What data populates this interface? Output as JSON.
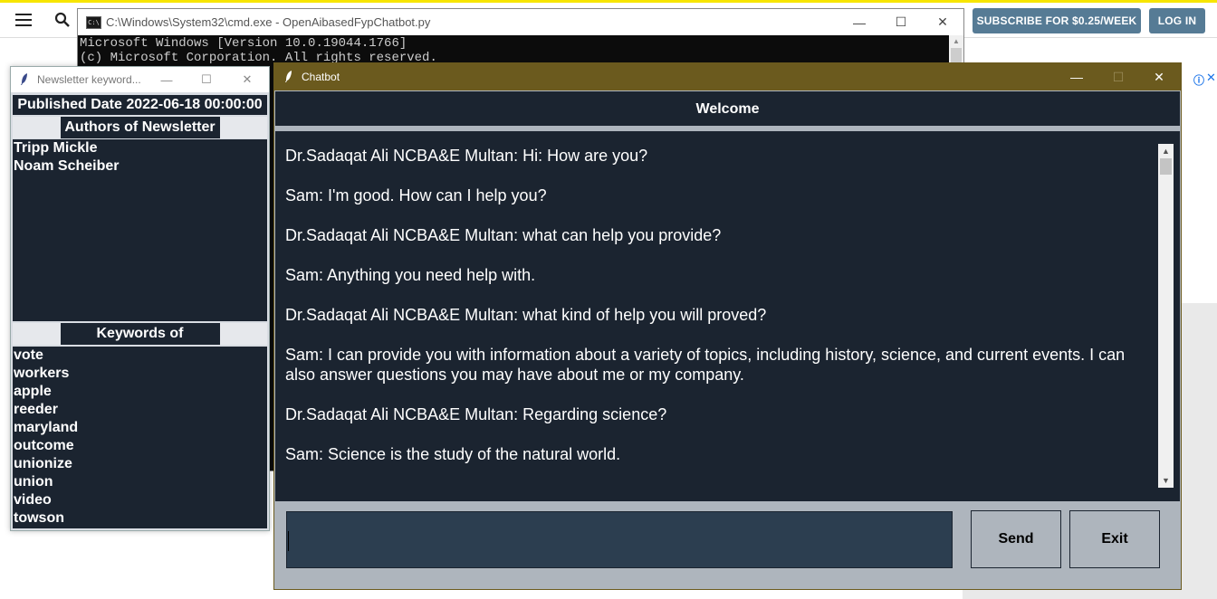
{
  "browser": {
    "subscribe_label": "SUBSCRIBE FOR $0.25/WEEK",
    "login_label": "LOG IN",
    "ad_info": "ⓘ",
    "ad_close": "✕"
  },
  "cmd": {
    "title": "C:\\Windows\\System32\\cmd.exe - OpenAibasedFypChatbot.py",
    "lines": [
      "Microsoft Windows [Version 10.0.19044.1766]",
      "(c) Microsoft Corporation. All rights reserved."
    ]
  },
  "newsletter": {
    "title": "Newsletter keyword...",
    "published": "Published Date 2022-06-18 00:00:00",
    "authors_heading": "Authors of Newsletter",
    "authors": [
      "Tripp Mickle",
      "Noam Scheiber"
    ],
    "keywords_heading": "Keywords of Newsletter",
    "keywords": [
      "vote",
      "workers",
      "apple",
      "reeder",
      "maryland",
      "outcome",
      "unionize",
      "union",
      "video",
      "towson"
    ]
  },
  "chatbot": {
    "title": "Chatbot",
    "header": "Welcome",
    "messages": [
      "Dr.Sadaqat Ali NCBA&E Multan: Hi: How are you?",
      "Sam: I'm good. How can I help you?",
      "Dr.Sadaqat Ali NCBA&E Multan: what can help you provide?",
      "Sam: Anything you need help with.",
      "Dr.Sadaqat Ali NCBA&E Multan: what kind of help you will proved?",
      "Sam: I can provide you with information about a variety of topics, including history, science, and current events. I can",
      "also answer questions you may have about me or my company.",
      "Dr.Sadaqat Ali NCBA&E Multan: Regarding science?",
      "Sam: Science is the study of the natural world."
    ],
    "input_value": "",
    "send_label": "Send",
    "exit_label": "Exit"
  },
  "icons": {
    "minimize": "—",
    "maximize": "☐",
    "close": "✕",
    "scroll_up": "▲",
    "scroll_down": "▼"
  }
}
